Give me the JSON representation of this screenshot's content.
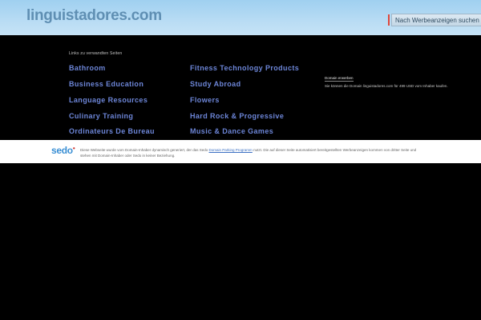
{
  "header": {
    "site_title": "linguistadores.com",
    "search_button": "Nach Werbeanzeigen suchen"
  },
  "links": {
    "heading": "Links zu verwandten Seiten",
    "left": [
      "Bathroom",
      "Business Education",
      "Language Resources",
      "Culinary Training",
      "Ordinateurs De Bureau"
    ],
    "right": [
      "Fitness Technology Products",
      "Study Abroad",
      "Flowers",
      "Hard Rock & Progressive",
      "Music & Dance Games"
    ]
  },
  "sidebar": {
    "title": "Domain erwerben",
    "text": "Sie können die Domain linguistadores.com für 499 USD vom Inhaber kaufen."
  },
  "footer": {
    "logo": "sedo",
    "text_1": "Diese Webseite wurde vom Domain-Inhaber dynamisch generiert, der das Sedo",
    "link": "Domain Parking Programm",
    "text_2": "nutzt. Die auf dieser Seite automatisiert bereitgestellten Werbeanzeigen kommen von dritter Seite und stehen mit Domain-Inhaber oder Sedo in keiner Beziehung."
  },
  "colors": {
    "header_bg": "#b9dcf4",
    "title": "#5f8fb3",
    "link": "#6d86d8",
    "background": "#000000",
    "sedo_blue": "#3a8fd4"
  }
}
